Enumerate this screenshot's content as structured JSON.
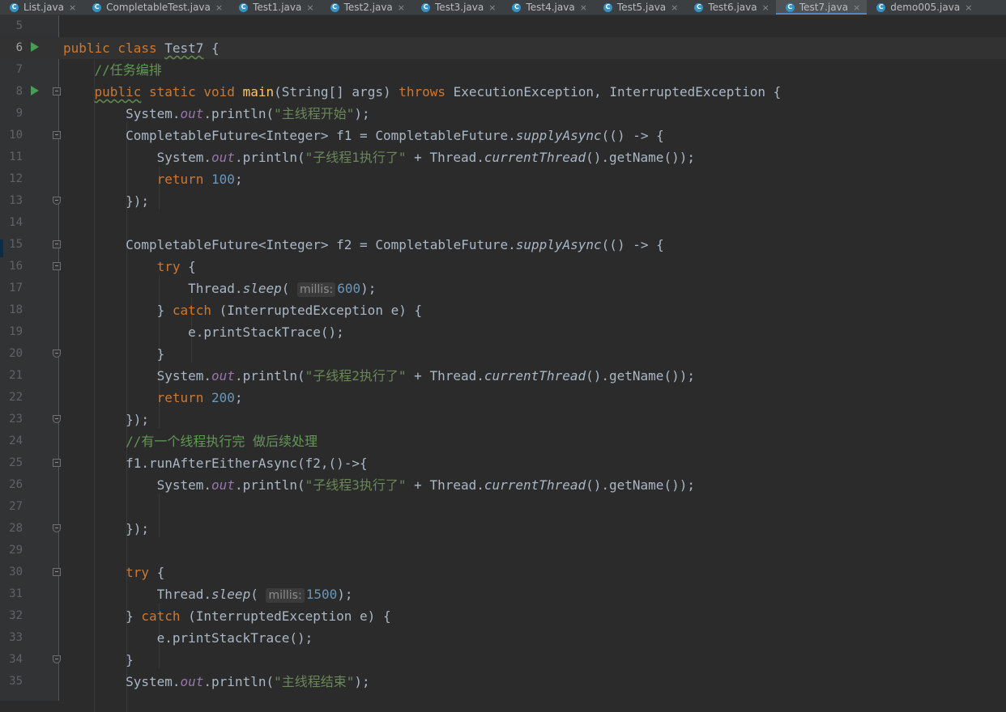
{
  "tabs": [
    {
      "label": "List.java",
      "active": false
    },
    {
      "label": "CompletableTest.java",
      "active": false
    },
    {
      "label": "Test1.java",
      "active": false
    },
    {
      "label": "Test2.java",
      "active": false
    },
    {
      "label": "Test3.java",
      "active": false
    },
    {
      "label": "Test4.java",
      "active": false
    },
    {
      "label": "Test5.java",
      "active": false
    },
    {
      "label": "Test6.java",
      "active": false
    },
    {
      "label": "Test7.java",
      "active": true
    },
    {
      "label": "demo005.java",
      "active": false
    }
  ],
  "tab_icon_letter": "C",
  "tab_close_glyph": "×",
  "current_line": 6,
  "lines": [
    {
      "n": 5,
      "tokens": []
    },
    {
      "n": 6,
      "run": true,
      "tokens": [
        [
          "k",
          "public class "
        ],
        [
          "typo",
          "Test7"
        ],
        [
          "p",
          " {"
        ]
      ]
    },
    {
      "n": 7,
      "tokens": [
        [
          "p",
          "    "
        ],
        [
          "c",
          "//任务编排"
        ]
      ]
    },
    {
      "n": 8,
      "run": true,
      "fold": "start",
      "tokens": [
        [
          "p",
          "    "
        ],
        [
          "k typo",
          "public"
        ],
        [
          "k",
          " static void "
        ],
        [
          "m",
          "main"
        ],
        [
          "p",
          "(String[] args) "
        ],
        [
          "k",
          "throws "
        ],
        [
          "p",
          "ExecutionException, InterruptedException {"
        ]
      ]
    },
    {
      "n": 9,
      "tokens": [
        [
          "p",
          "        System."
        ],
        [
          "f",
          "out"
        ],
        [
          "p",
          ".println("
        ],
        [
          "s",
          "\"主线程开始\""
        ],
        [
          "p",
          ");"
        ]
      ]
    },
    {
      "n": 10,
      "fold": "start",
      "tokens": [
        [
          "p",
          "        CompletableFuture<Integer> f1 = CompletableFuture."
        ],
        [
          "i",
          "supplyAsync"
        ],
        [
          "p",
          "(() -> {"
        ]
      ]
    },
    {
      "n": 11,
      "tokens": [
        [
          "p",
          "            System."
        ],
        [
          "f",
          "out"
        ],
        [
          "p",
          ".println("
        ],
        [
          "s",
          "\"子线程1执行了\""
        ],
        [
          "p",
          " + Thread."
        ],
        [
          "i",
          "currentThread"
        ],
        [
          "p",
          "().getName());"
        ]
      ]
    },
    {
      "n": 12,
      "tokens": [
        [
          "p",
          "            "
        ],
        [
          "k",
          "return "
        ],
        [
          "n",
          "100"
        ],
        [
          "p",
          ";"
        ]
      ]
    },
    {
      "n": 13,
      "fold": "end",
      "tokens": [
        [
          "p",
          "        });"
        ]
      ]
    },
    {
      "n": 14,
      "tokens": []
    },
    {
      "n": 15,
      "fold": "start",
      "tokens": [
        [
          "p",
          "        CompletableFuture<Integer> f2 = CompletableFuture."
        ],
        [
          "i",
          "supplyAsync"
        ],
        [
          "p",
          "(() -> {"
        ]
      ]
    },
    {
      "n": 16,
      "fold": "start",
      "tokens": [
        [
          "p",
          "            "
        ],
        [
          "k",
          "try "
        ],
        [
          "p",
          "{"
        ]
      ]
    },
    {
      "n": 17,
      "tokens": [
        [
          "p",
          "                Thread."
        ],
        [
          "i",
          "sleep"
        ],
        [
          "p",
          "( "
        ],
        [
          "hint",
          "millis:"
        ],
        [
          "n",
          "600"
        ],
        [
          "p",
          ");"
        ]
      ]
    },
    {
      "n": 18,
      "tokens": [
        [
          "p",
          "            } "
        ],
        [
          "k",
          "catch "
        ],
        [
          "p",
          "(InterruptedException e) {"
        ]
      ]
    },
    {
      "n": 19,
      "tokens": [
        [
          "p",
          "                e.printStackTrace();"
        ]
      ]
    },
    {
      "n": 20,
      "fold": "end",
      "tokens": [
        [
          "p",
          "            }"
        ]
      ]
    },
    {
      "n": 21,
      "tokens": [
        [
          "p",
          "            System."
        ],
        [
          "f",
          "out"
        ],
        [
          "p",
          ".println("
        ],
        [
          "s",
          "\"子线程2执行了\""
        ],
        [
          "p",
          " + Thread."
        ],
        [
          "i",
          "currentThread"
        ],
        [
          "p",
          "().getName());"
        ]
      ]
    },
    {
      "n": 22,
      "tokens": [
        [
          "p",
          "            "
        ],
        [
          "k",
          "return "
        ],
        [
          "n",
          "200"
        ],
        [
          "p",
          ";"
        ]
      ]
    },
    {
      "n": 23,
      "fold": "end",
      "tokens": [
        [
          "p",
          "        });"
        ]
      ]
    },
    {
      "n": 24,
      "tokens": [
        [
          "p",
          "        "
        ],
        [
          "c",
          "//有一个线程执行完 做后续处理"
        ]
      ]
    },
    {
      "n": 25,
      "fold": "start",
      "tokens": [
        [
          "p",
          "        f1.runAfterEitherAsync(f2,()->{"
        ]
      ]
    },
    {
      "n": 26,
      "tokens": [
        [
          "p",
          "            System."
        ],
        [
          "f",
          "out"
        ],
        [
          "p",
          ".println("
        ],
        [
          "s",
          "\"子线程3执行了\""
        ],
        [
          "p",
          " + Thread."
        ],
        [
          "i",
          "currentThread"
        ],
        [
          "p",
          "().getName());"
        ]
      ]
    },
    {
      "n": 27,
      "tokens": []
    },
    {
      "n": 28,
      "fold": "end",
      "tokens": [
        [
          "p",
          "        });"
        ]
      ]
    },
    {
      "n": 29,
      "tokens": []
    },
    {
      "n": 30,
      "fold": "start",
      "tokens": [
        [
          "p",
          "        "
        ],
        [
          "k",
          "try "
        ],
        [
          "p",
          "{"
        ]
      ]
    },
    {
      "n": 31,
      "tokens": [
        [
          "p",
          "            Thread."
        ],
        [
          "i",
          "sleep"
        ],
        [
          "p",
          "( "
        ],
        [
          "hint",
          "millis:"
        ],
        [
          "n",
          "1500"
        ],
        [
          "p",
          ");"
        ]
      ]
    },
    {
      "n": 32,
      "tokens": [
        [
          "p",
          "        } "
        ],
        [
          "k",
          "catch "
        ],
        [
          "p",
          "(InterruptedException e) {"
        ]
      ]
    },
    {
      "n": 33,
      "tokens": [
        [
          "p",
          "            e.printStackTrace();"
        ]
      ]
    },
    {
      "n": 34,
      "fold": "end",
      "tokens": [
        [
          "p",
          "        }"
        ]
      ]
    },
    {
      "n": 35,
      "tokens": [
        [
          "p",
          "        System."
        ],
        [
          "f",
          "out"
        ],
        [
          "p",
          ".println("
        ],
        [
          "s",
          "\"主线程结束\""
        ],
        [
          "p",
          ");"
        ]
      ]
    }
  ]
}
